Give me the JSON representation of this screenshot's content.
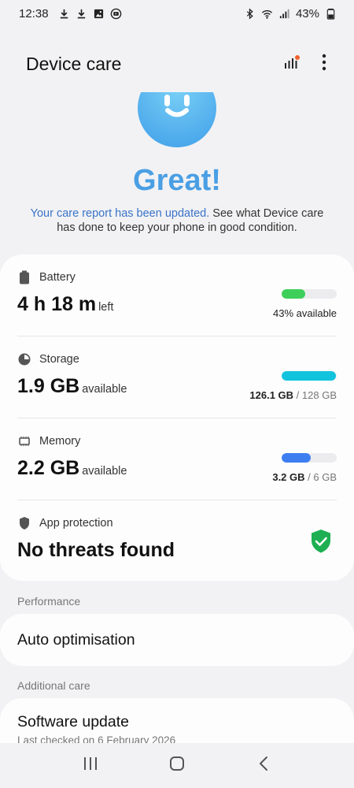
{
  "status_bar": {
    "time": "12:38",
    "battery_percent": "43%",
    "left_icons": [
      "download-icon",
      "download-icon",
      "image-icon",
      "media-icon"
    ],
    "right_icons": [
      "bluetooth-icon",
      "wifi-icon",
      "signal-icon",
      "battery-icon"
    ]
  },
  "header": {
    "title": "Device care",
    "actions": [
      "diagnostics-icon",
      "more-options-icon"
    ]
  },
  "hero": {
    "status_word": "Great!",
    "report_link": "Your care report has been updated.",
    "report_text": " See what Device care has done to keep your phone in good condition."
  },
  "battery": {
    "label": "Battery",
    "value": "4 h 18 m",
    "unit": "left",
    "meta": "43% available",
    "level": 0.43,
    "color": "#3ecf5a"
  },
  "storage": {
    "label": "Storage",
    "value": "1.9 GB",
    "unit": "available",
    "used": "126.1 GB",
    "total": "128 GB",
    "level": 0.985,
    "color": "#12c3dd"
  },
  "memory": {
    "label": "Memory",
    "value": "2.2 GB",
    "unit": "available",
    "used": "3.2 GB",
    "total": "6 GB",
    "level": 0.53,
    "color": "#3d7ff0"
  },
  "protection": {
    "label": "App protection",
    "value": "No threats found",
    "color": "#1daf52"
  },
  "performance": {
    "section_label": "Performance",
    "item": "Auto optimisation"
  },
  "additional": {
    "section_label": "Additional care",
    "item": "Software update",
    "subtitle": "Last checked on 6 February 2026"
  },
  "nav": [
    "recents-icon",
    "home-icon",
    "back-icon"
  ],
  "colors": {
    "accent": "#4a9fe4",
    "link": "#3a73c8",
    "background": "#f2f2f4",
    "card": "#fdfdfd"
  }
}
